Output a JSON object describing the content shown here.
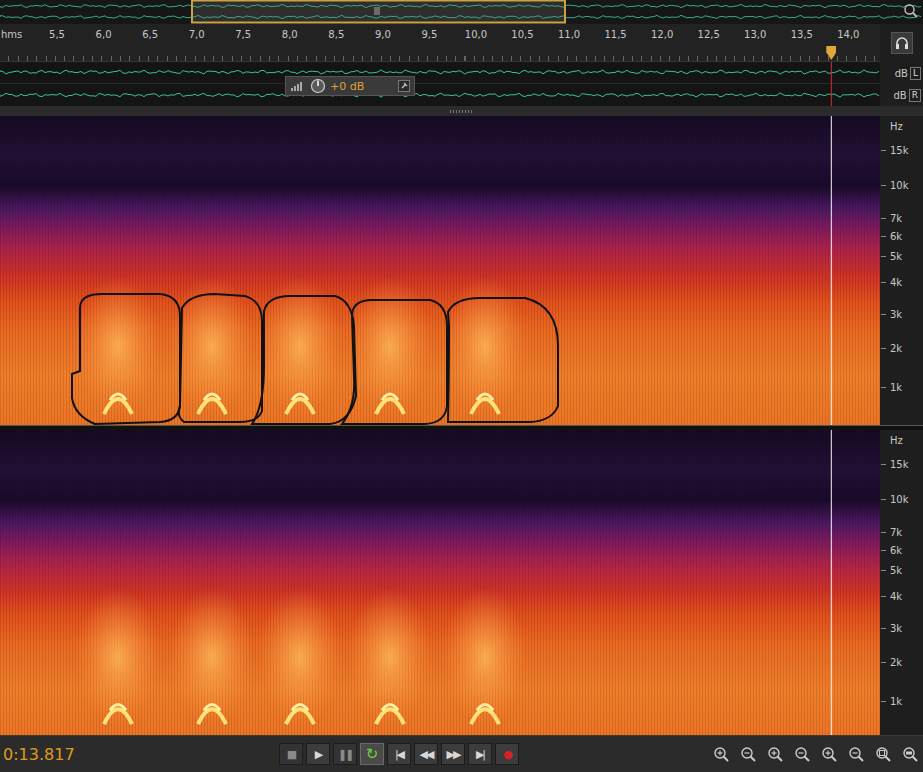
{
  "ruler": {
    "unit": "hms",
    "ticks": [
      "5,5",
      "6,0",
      "6,5",
      "7,0",
      "7,5",
      "8,0",
      "8,5",
      "9,0",
      "9,5",
      "10,0",
      "10,5",
      "11,0",
      "11,5",
      "12,0",
      "12,5",
      "13,0",
      "13,5",
      "14,0"
    ]
  },
  "hud": {
    "gain": "+0 dB"
  },
  "waveform_channels": [
    {
      "unit": "dB",
      "label": "L"
    },
    {
      "unit": "dB",
      "label": "R"
    }
  ],
  "spectrogram_channels": [
    {
      "axis_unit": "Hz",
      "ticks": [
        "15k",
        "10k",
        "7k",
        "6k",
        "5k",
        "4k",
        "3k",
        "2k",
        "1k"
      ],
      "annotated": true
    },
    {
      "axis_unit": "Hz",
      "ticks": [
        "15k",
        "10k",
        "7k",
        "6k",
        "5k",
        "4k",
        "3k",
        "2k",
        "1k"
      ],
      "annotated": false
    }
  ],
  "current_time": "0:13.817",
  "transport": [
    {
      "icon": "■",
      "selected": false,
      "disabled": true,
      "color": "#8a8a8a"
    },
    {
      "icon": "▶",
      "selected": false,
      "disabled": false,
      "color": "#d8d8d8"
    },
    {
      "icon": "❚❚",
      "selected": false,
      "disabled": true,
      "color": "#8a8a8a"
    },
    {
      "icon": "↻",
      "selected": true,
      "disabled": false,
      "color": "#6fd03a"
    },
    {
      "icon": "|◀",
      "selected": false,
      "disabled": false,
      "color": "#d8d8d8"
    },
    {
      "icon": "◀◀",
      "selected": false,
      "disabled": false,
      "color": "#d8d8d8"
    },
    {
      "icon": "▶▶",
      "selected": false,
      "disabled": false,
      "color": "#d8d8d8"
    },
    {
      "icon": "▶|",
      "selected": false,
      "disabled": false,
      "color": "#d8d8d8"
    },
    {
      "icon": "●",
      "selected": false,
      "disabled": false,
      "color": "#d82020"
    }
  ]
}
